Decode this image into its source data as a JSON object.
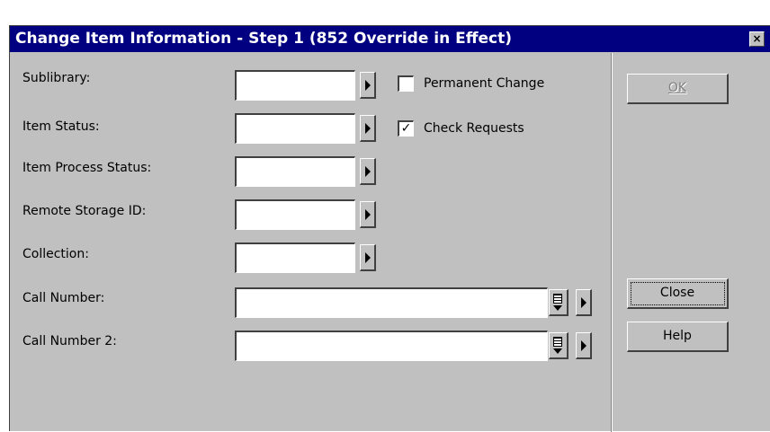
{
  "window": {
    "title": "Change Item Information - Step 1 (852 Override in Effect)",
    "close_glyph": "×"
  },
  "form": {
    "sublibrary": {
      "label": "Sublibrary:",
      "value": ""
    },
    "item_status": {
      "label": "Item Status:",
      "value": ""
    },
    "item_process_status": {
      "label": "Item Process Status:",
      "value": ""
    },
    "remote_storage_id": {
      "label": "Remote Storage ID:",
      "value": ""
    },
    "collection": {
      "label": "Collection:",
      "value": ""
    },
    "call_number": {
      "label": "Call Number:",
      "value": ""
    },
    "call_number_2": {
      "label": "Call Number 2:",
      "value": ""
    }
  },
  "options": {
    "permanent_change": {
      "label": "Permanent Change",
      "checked": false,
      "mark": ""
    },
    "check_requests": {
      "label": "Check Requests",
      "checked": true,
      "mark": "✓"
    }
  },
  "buttons": {
    "ok": {
      "label": "OK",
      "enabled": false
    },
    "close": {
      "label": "Close",
      "enabled": true
    },
    "help": {
      "label": "Help",
      "enabled": true
    }
  },
  "colors": {
    "title_bar": "#000080",
    "dialog_face": "#c0c0c0"
  },
  "icons": {
    "dropdown": "triangle-right-icon",
    "list": "list-icon",
    "close": "close-icon"
  }
}
